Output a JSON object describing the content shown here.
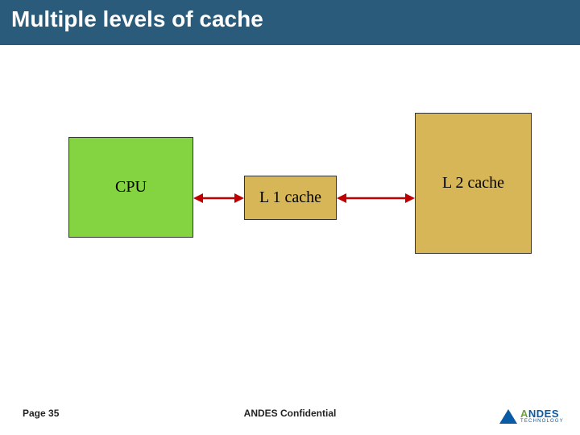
{
  "slide": {
    "title": "Multiple levels of cache"
  },
  "diagram": {
    "cpu_label": "CPU",
    "l1_label": "L 1 cache",
    "l2_label": "L 2 cache"
  },
  "footer": {
    "page": "Page 35",
    "confidential": "ANDES Confidential"
  },
  "logo": {
    "brand_green": "A",
    "brand_blue": "NDES",
    "sub": "TECHNOLOGY"
  }
}
